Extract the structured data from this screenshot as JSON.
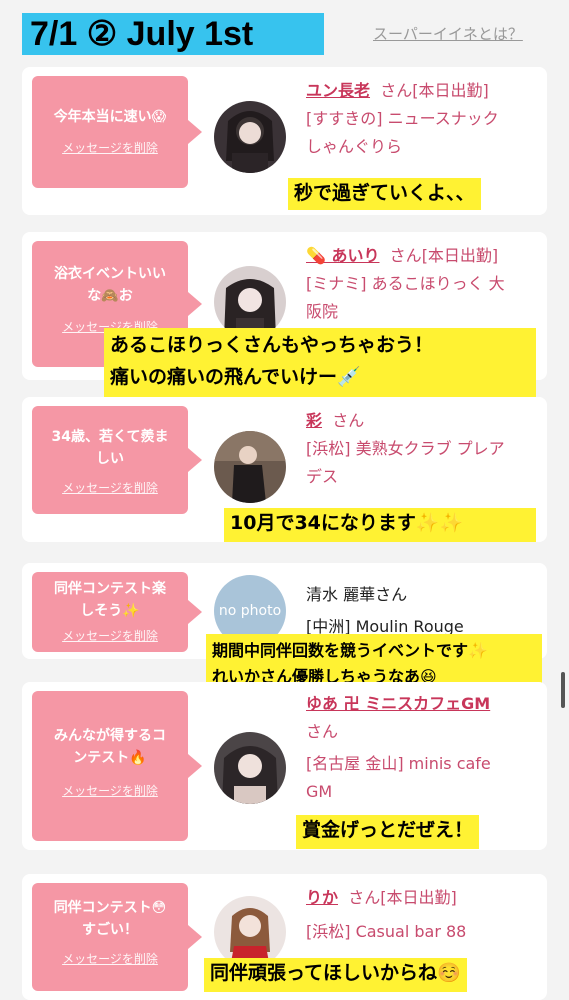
{
  "header": {
    "title": "7/1 ② July 1st",
    "link": "スーパーイイネとは？"
  },
  "delete_label": "メッセージを削除",
  "cards": [
    {
      "msg1": "今年本当に速い😱",
      "msg2": "",
      "name": "ユン長老",
      "san": "さん",
      "status": "[本日出勤]",
      "line2": "[すすきの] ニュースナック",
      "line3": "しゃんぐりら",
      "note1": "秒で過ぎていくよ、、",
      "note2": ""
    },
    {
      "msg1": "浴衣イベントいい",
      "msg2": "な🙈お",
      "name": "💊 あいり",
      "san": "さん",
      "status": "[本日出勤]",
      "line2": "[ミナミ] あるこほりっく 大",
      "line3": "阪院",
      "note1": "あるこほりっくさんもやっちゃおう！",
      "note2": "痛いの痛いの飛んでいけー💉"
    },
    {
      "msg1": "34歳、若くて羨ま",
      "msg2": "しい",
      "name": "彩",
      "san": "さん",
      "status": "",
      "line2": "[浜松] 美熟女クラブ プレア",
      "line3": "デス",
      "note1": "10月で34になります✨✨",
      "note2": ""
    },
    {
      "msg1": "同伴コンテスト楽",
      "msg2": "しそう✨",
      "name": "清水 麗華さん",
      "san": "",
      "status": "",
      "line2": "[中洲] Moulin Rouge",
      "line3": "",
      "avatar_text": "no photo",
      "note1": "期間中同伴回数を競うイベントです✨",
      "note2": "れいかさん優勝しちゃうなあ😆"
    },
    {
      "msg1": "みんなが得するコ",
      "msg2": "ンテスト🔥",
      "name": "ゆあ 卍 ミニスカフェGM",
      "san": "さん",
      "status": "",
      "line2": "[名古屋 金山] minis cafe",
      "line3": "GM",
      "note1": "賞金げっとだぜえ！",
      "note2": ""
    },
    {
      "msg1": "同伴コンテスト😳",
      "msg2": "すごい！",
      "name": "りか",
      "san": "さん",
      "status": "[本日出勤]",
      "line2": "[浜松] Casual bar 88",
      "line3": "",
      "note1": "同伴頑張ってほしいからね☺️",
      "note2": ""
    }
  ],
  "colors": {
    "title_bg": "#37c3ee",
    "bubble": "#f597a5",
    "name": "#c8365a",
    "note_bg": "#fff233"
  }
}
